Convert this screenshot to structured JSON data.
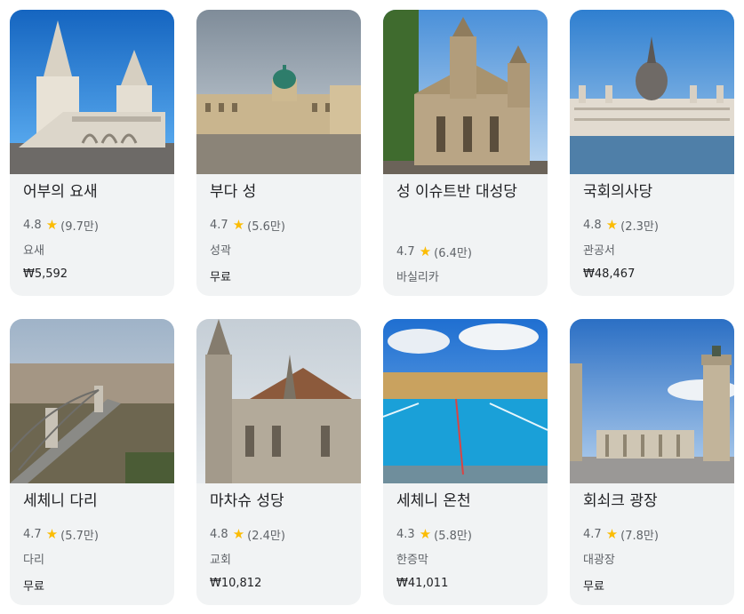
{
  "attractions": [
    {
      "name": "어부의 요새",
      "rating": "4.8",
      "reviews": "(9.7만)",
      "category": "요새",
      "price": "₩5,592"
    },
    {
      "name": "부다 성",
      "rating": "4.7",
      "reviews": "(5.6만)",
      "category": "성곽",
      "price": "무료"
    },
    {
      "name": "성 이슈트반 대성당",
      "rating": "4.7",
      "reviews": "(6.4만)",
      "category": "바실리카",
      "price": ""
    },
    {
      "name": "국회의사당",
      "rating": "4.8",
      "reviews": "(2.3만)",
      "category": "관공서",
      "price": "₩48,467"
    },
    {
      "name": "세체니 다리",
      "rating": "4.7",
      "reviews": "(5.7만)",
      "category": "다리",
      "price": "무료"
    },
    {
      "name": "마차슈 성당",
      "rating": "4.8",
      "reviews": "(2.4만)",
      "category": "교회",
      "price": "₩10,812"
    },
    {
      "name": "세체니 온천",
      "rating": "4.3",
      "reviews": "(5.8만)",
      "category": "한증막",
      "price": "₩41,011"
    },
    {
      "name": "회쇠크 광장",
      "rating": "4.7",
      "reviews": "(7.8만)",
      "category": "대광장",
      "price": "무료"
    }
  ],
  "colors": {
    "card_bg": "#f1f3f4",
    "star": "#fbbc04",
    "text_primary": "#202124",
    "text_secondary": "#5f6368"
  },
  "icons": {
    "star": "star-icon"
  }
}
